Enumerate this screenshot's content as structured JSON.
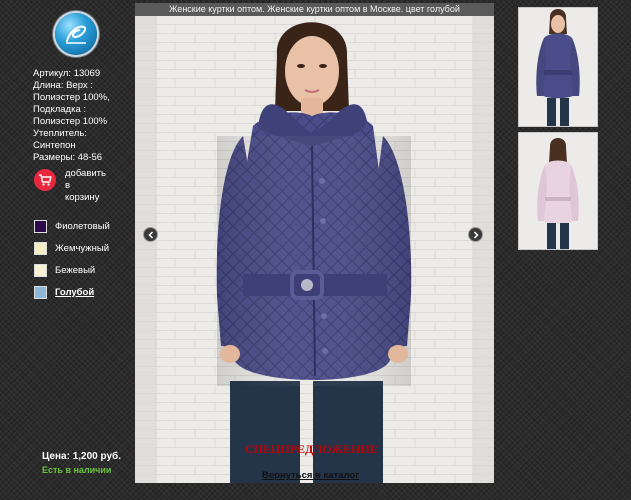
{
  "header": {
    "title": "Женские куртки оптом. Женские куртки оптом в Москве. цвет голубой"
  },
  "specs": [
    "Артикул: 13069",
    "Длина: Верх :",
    "Полиэстер 100%,",
    "Подкладка :",
    "Полиэстер 100%",
    "Утеплитель:",
    "Синтепон",
    "Размеры: 48-56"
  ],
  "cart": {
    "line1": "добавить",
    "line2": "в",
    "line3": "корзину",
    "icon": "shopping-cart-icon"
  },
  "colors": [
    {
      "label": "Фиолетовый",
      "swatch": "#2a0a4a"
    },
    {
      "label": "Жемчужный",
      "swatch": "#f4eec6"
    },
    {
      "label": "Бежевый",
      "swatch": "#f7f1d3"
    },
    {
      "label": "Голубой",
      "swatch": "#8fb8d8",
      "selected": true
    }
  ],
  "price": {
    "text": "Цена: 1,200 руб."
  },
  "stock": {
    "text": "Есть в наличии",
    "color": "#6cc33f"
  },
  "promo": {
    "text": "СПЕЦПРЕДЛОЖЕНИЕ",
    "color": "#c00000"
  },
  "back_link": {
    "text": "Вернуться в каталог"
  },
  "nav": {
    "prev_icon": "chevron-left-icon",
    "next_icon": "chevron-right-icon"
  },
  "theme": {
    "jacket": "#4b4d8a",
    "jacket_pink": "#e8d3e0",
    "background": "#2b2b2b"
  }
}
